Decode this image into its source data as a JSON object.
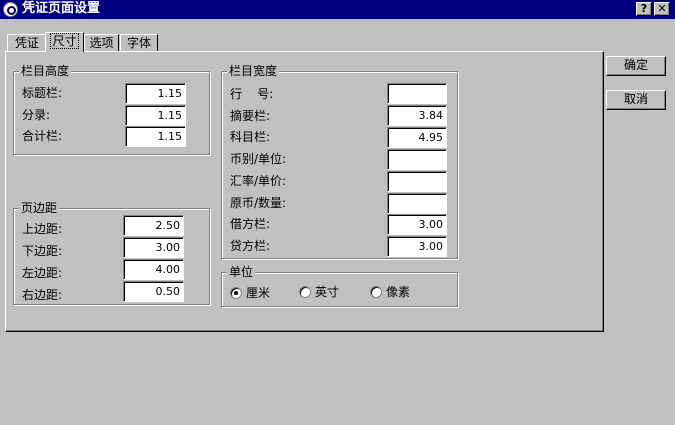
{
  "window": {
    "title": "凭证页面设置",
    "help_label": "?",
    "close_label": "✕"
  },
  "tabs": [
    {
      "label": "凭证",
      "active": false
    },
    {
      "label": "尺寸",
      "active": true
    },
    {
      "label": "选项",
      "active": false
    },
    {
      "label": "字体",
      "active": false
    }
  ],
  "row_height": {
    "title": "栏目高度",
    "fields": [
      {
        "label": "标题栏:",
        "value": "1.15"
      },
      {
        "label": "分录:",
        "value": "1.15"
      },
      {
        "label": "合计栏:",
        "value": "1.15"
      }
    ]
  },
  "margins": {
    "title": "页边距",
    "fields": [
      {
        "label": "上边距:",
        "value": "2.50"
      },
      {
        "label": "下边距:",
        "value": "3.00"
      },
      {
        "label": "左边距:",
        "value": "4.00"
      },
      {
        "label": "右边距:",
        "value": "0.50"
      }
    ]
  },
  "col_width": {
    "title": "栏目宽度",
    "fields": [
      {
        "label": "行    号:",
        "value": ""
      },
      {
        "label": "摘要栏:",
        "value": "3.84"
      },
      {
        "label": "科目栏:",
        "value": "4.95"
      },
      {
        "label": "币别/单位:",
        "value": ""
      },
      {
        "label": "汇率/单价:",
        "value": ""
      },
      {
        "label": "原币/数量:",
        "value": ""
      },
      {
        "label": "借方栏:",
        "value": "3.00"
      },
      {
        "label": "贷方栏:",
        "value": "3.00"
      }
    ]
  },
  "units": {
    "title": "单位",
    "options": [
      {
        "label": "厘米",
        "checked": true
      },
      {
        "label": "英寸",
        "checked": false
      },
      {
        "label": "像素",
        "checked": false
      }
    ]
  },
  "buttons": {
    "ok": "确定",
    "cancel": "取消"
  }
}
